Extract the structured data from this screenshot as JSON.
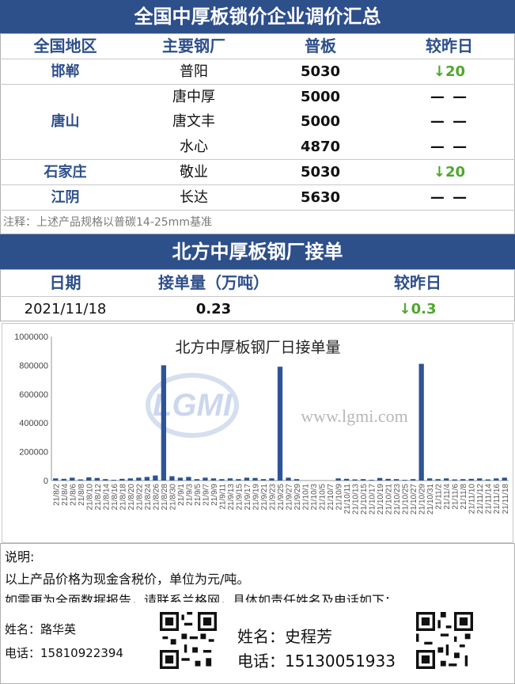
{
  "section1": {
    "title": "全国中厚板锁价企业调价汇总",
    "headers": [
      "全国地区",
      "主要钢厂",
      "普板",
      "较昨日"
    ],
    "regions": [
      "邯郸",
      "唐山",
      "石家庄",
      "江阴"
    ],
    "rows": [
      {
        "plant": "普阳",
        "price": "5030",
        "change": "↓20",
        "dir": "down"
      },
      {
        "plant": "唐中厚",
        "price": "5000",
        "change": "— —",
        "dir": "flat"
      },
      {
        "plant": "唐文丰",
        "price": "5000",
        "change": "— —",
        "dir": "flat"
      },
      {
        "plant": "水心",
        "price": "4870",
        "change": "— —",
        "dir": "flat"
      },
      {
        "plant": "敬业",
        "price": "5030",
        "change": "↓20",
        "dir": "down"
      },
      {
        "plant": "长达",
        "price": "5630",
        "change": "— —",
        "dir": "flat"
      }
    ],
    "note": "注释：上述产品规格以普碳14-25mm基准"
  },
  "section2": {
    "title": "北方中厚板钢厂接单",
    "headers": [
      "日期",
      "接单量（万吨）",
      "较昨日"
    ],
    "row": {
      "date": "2021/11/18",
      "amount": "0.23",
      "change": "↓0.3"
    }
  },
  "watermark": {
    "logo": "LGMI",
    "url": "www.lgmi.com"
  },
  "chart_data": {
    "type": "bar",
    "title": "北方中厚板钢厂日接单量",
    "ylim": [
      0,
      1000000
    ],
    "yticks": [
      0,
      200000,
      400000,
      600000,
      800000,
      1000000
    ],
    "ytick_labels": [
      "0",
      "200000",
      "400000",
      "600000",
      "800000",
      "1000000"
    ],
    "grid": false,
    "legend": "none",
    "color": "#2d5496",
    "categories": [
      "21/8/2",
      "21/8/4",
      "21/8/6",
      "21/8/8",
      "21/8/10",
      "21/8/12",
      "21/8/14",
      "21/8/16",
      "21/8/18",
      "21/8/20",
      "21/8/22",
      "21/8/24",
      "21/8/26",
      "21/8/28",
      "21/8/30",
      "21/9/1",
      "21/9/3",
      "21/9/5",
      "21/9/7",
      "21/9/9",
      "21/9/11",
      "21/9/13",
      "21/9/15",
      "21/9/17",
      "21/9/19",
      "21/9/21",
      "21/9/23",
      "21/9/25",
      "21/9/27",
      "21/9/29",
      "21/10/1",
      "21/10/3",
      "21/10/5",
      "21/10/7",
      "21/10/9",
      "21/10/11",
      "21/10/13",
      "21/10/15",
      "21/10/17",
      "21/10/19",
      "21/10/21",
      "21/10/23",
      "21/10/25",
      "21/10/27",
      "21/10/29",
      "21/10/31",
      "21/11/2",
      "21/11/4",
      "21/11/6",
      "21/11/8",
      "21/11/10",
      "21/11/12",
      "21/11/14",
      "21/11/16",
      "21/11/18"
    ],
    "values": [
      15000,
      12000,
      20000,
      8000,
      22000,
      18000,
      10000,
      5000,
      12000,
      15000,
      20000,
      25000,
      35000,
      800000,
      30000,
      20000,
      25000,
      10000,
      20000,
      15000,
      10000,
      15000,
      10000,
      20000,
      18000,
      10000,
      15000,
      790000,
      20000,
      10000,
      0,
      0,
      0,
      0,
      15000,
      12000,
      8000,
      10000,
      5000,
      18000,
      12000,
      10000,
      5000,
      10000,
      810000,
      15000,
      10000,
      15000,
      8000,
      10000,
      12000,
      15000,
      8000,
      15000,
      20000
    ]
  },
  "section3": {
    "title": "说明:",
    "line1": "以上产品价格为现金含税价，单位为元/吨。",
    "line2": "如需更为全面数据报告，请联系兰格网，具体如责任姓名及电话如下：",
    "contact1": {
      "name": "姓名：路华英",
      "phone": "电话：15810922394"
    },
    "contact2": {
      "name": "姓名：史程芳",
      "phone": "电话：15130051933"
    }
  }
}
